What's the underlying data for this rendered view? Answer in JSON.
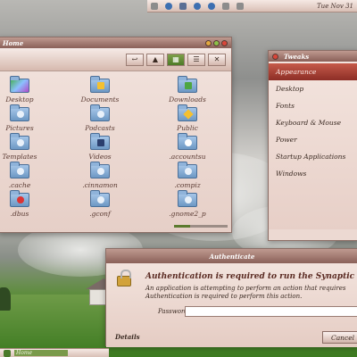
{
  "top_panel": {
    "clock": "Tue Nov 31"
  },
  "home_window": {
    "title": "Home",
    "toolbar": {
      "back": "↩",
      "up": "▲",
      "icon_view": "▦",
      "list_view": "☰",
      "compact_view": "✕"
    },
    "items": [
      {
        "label": "Desktop",
        "icon": "desktop-folder-icon"
      },
      {
        "label": "Documents",
        "icon": "documents-folder-icon"
      },
      {
        "label": "Downloads",
        "icon": "downloads-folder-icon"
      },
      {
        "label": "Pictures",
        "icon": "pictures-folder-icon"
      },
      {
        "label": "Podcasts",
        "icon": "podcasts-folder-icon"
      },
      {
        "label": "Public",
        "icon": "public-folder-icon"
      },
      {
        "label": "Templates",
        "icon": "templates-folder-icon"
      },
      {
        "label": "Videos",
        "icon": "videos-folder-icon"
      },
      {
        "label": ".accountsu",
        "icon": "hidden-folder-icon"
      },
      {
        "label": ".cache",
        "icon": "hidden-folder-icon"
      },
      {
        "label": ".cinnamon",
        "icon": "hidden-folder-icon"
      },
      {
        "label": ".compiz",
        "icon": "hidden-folder-icon"
      },
      {
        "label": ".dbus",
        "icon": "hidden-folder-icon"
      },
      {
        "label": ".gconf",
        "icon": "hidden-folder-icon"
      },
      {
        "label": ".gnome2_p",
        "icon": "hidden-folder-icon"
      }
    ]
  },
  "tweaks_window": {
    "title": "Tweaks",
    "items": [
      "Appearance",
      "Desktop",
      "Fonts",
      "Keyboard & Mouse",
      "Power",
      "Startup Applications",
      "Windows"
    ],
    "active_index": 0
  },
  "auth_dialog": {
    "title": "Authenticate",
    "heading": "Authentication is required to run the Synaptic",
    "description_line1": "An application is attempting to perform an action that requires",
    "description_line2": "Authentication is required to perform this action.",
    "password_label": "Password:",
    "password_value": "",
    "details_label": "Details",
    "cancel_label": "Cancel"
  },
  "bottom_panel": {
    "task_label": "Home"
  }
}
